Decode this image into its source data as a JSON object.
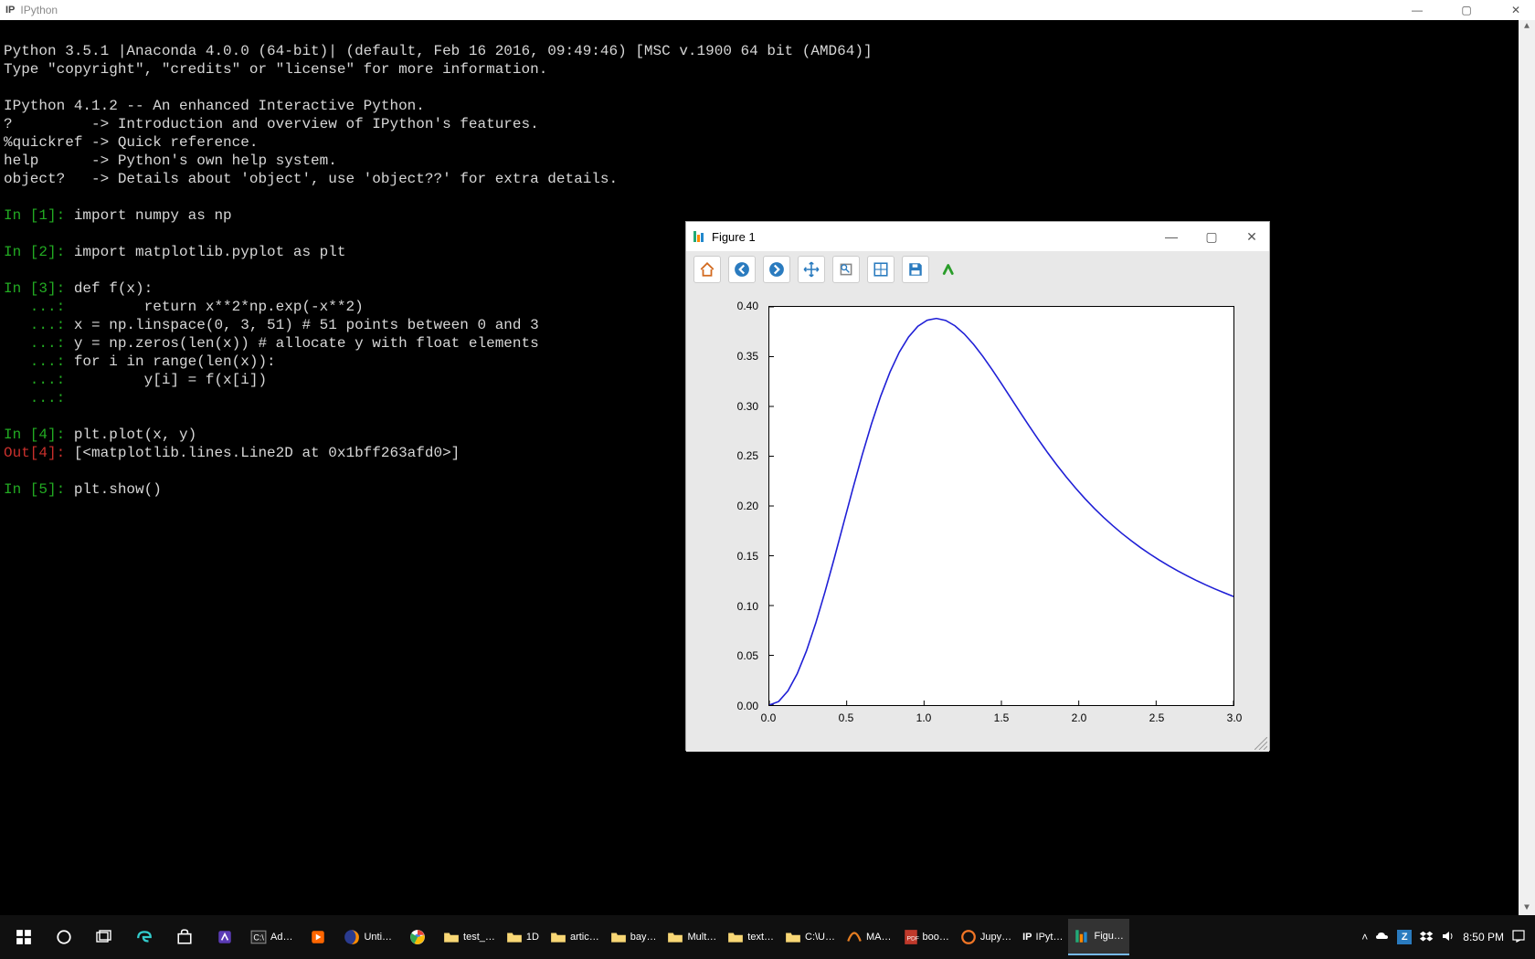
{
  "main_window": {
    "app_icon_text": "IP",
    "title": "IPython",
    "controls": {
      "min": "—",
      "max": "▢",
      "close": "✕"
    }
  },
  "terminal": {
    "line01": "Python 3.5.1 |Anaconda 4.0.0 (64-bit)| (default, Feb 16 2016, 09:49:46) [MSC v.1900 64 bit (AMD64)]",
    "line02": "Type \"copyright\", \"credits\" or \"license\" for more information.",
    "blank1": "",
    "line03": "IPython 4.1.2 -- An enhanced Interactive Python.",
    "line04": "?         -> Introduction and overview of IPython's features.",
    "line05": "%quickref -> Quick reference.",
    "line06": "help      -> Python's own help system.",
    "line07": "object?   -> Details about 'object', use 'object??' for extra details.",
    "blank2": "",
    "in1_prompt": "In [1]: ",
    "in1_code": "import numpy as np",
    "blank3": "",
    "in2_prompt": "In [2]: ",
    "in2_code": "import matplotlib.pyplot as plt",
    "blank4": "",
    "in3_prompt": "In [3]: ",
    "in3_code": "def f(x):",
    "cont_prompt": "   ...: ",
    "in3_l2": "        return x**2*np.exp(-x**2)",
    "in3_l3": "x = np.linspace(0, 3, 51) # 51 points between 0 and 3",
    "in3_l4": "y = np.zeros(len(x)) # allocate y with float elements",
    "in3_l5": "for i in range(len(x)):",
    "in3_l6": "        y[i] = f(x[i])",
    "in3_l7": "",
    "blank5": "",
    "in4_prompt": "In [4]: ",
    "in4_code": "plt.plot(x, y)",
    "out4_prompt": "Out[4]: ",
    "out4_val": "[<matplotlib.lines.Line2D at 0x1bff263afd0>]",
    "blank6": "",
    "in5_prompt": "In [5]: ",
    "in5_code": "plt.show()"
  },
  "figure_window": {
    "title": "Figure 1",
    "controls": {
      "min": "—",
      "max": "▢",
      "close": "✕"
    },
    "toolbar": {
      "home": "home-icon",
      "back": "back-icon",
      "forward": "forward-icon",
      "pan": "pan-icon",
      "zoom": "zoom-icon",
      "subplots": "subplots-icon",
      "save": "save-icon",
      "edit": "edit-icon"
    },
    "y_ticks": [
      "0.00",
      "0.05",
      "0.10",
      "0.15",
      "0.20",
      "0.25",
      "0.30",
      "0.35",
      "0.40"
    ],
    "x_ticks": [
      "0.0",
      "0.5",
      "1.0",
      "1.5",
      "2.0",
      "2.5",
      "3.0"
    ]
  },
  "chart_data": {
    "type": "line",
    "title": "",
    "xlabel": "",
    "ylabel": "",
    "xlim": [
      0.0,
      3.0
    ],
    "ylim": [
      0.0,
      0.4
    ],
    "x": [
      0.0,
      0.06,
      0.12,
      0.18,
      0.24,
      0.3,
      0.36,
      0.42,
      0.48,
      0.54,
      0.6,
      0.66,
      0.72,
      0.78,
      0.84,
      0.9,
      0.96,
      1.02,
      1.08,
      1.14,
      1.2,
      1.26,
      1.32,
      1.38,
      1.44,
      1.5,
      1.56,
      1.62,
      1.68,
      1.74,
      1.8,
      1.86,
      1.92,
      1.98,
      2.04,
      2.1,
      2.16,
      2.22,
      2.28,
      2.34,
      2.4,
      2.46,
      2.52,
      2.58,
      2.64,
      2.7,
      2.76,
      2.82,
      2.88,
      2.94,
      3.0
    ],
    "y": [
      0.0,
      0.0036,
      0.0142,
      0.0314,
      0.0544,
      0.0823,
      0.1138,
      0.1476,
      0.1826,
      0.2175,
      0.2511,
      0.2823,
      0.3104,
      0.3346,
      0.3545,
      0.3698,
      0.3805,
      0.3866,
      0.3884,
      0.3864,
      0.381,
      0.3728,
      0.3624,
      0.3503,
      0.337,
      0.323,
      0.3087,
      0.2943,
      0.2802,
      0.2665,
      0.2533,
      0.2408,
      0.229,
      0.2179,
      0.2074,
      0.1977,
      0.1886,
      0.1802,
      0.1723,
      0.165,
      0.1581,
      0.1517,
      0.1457,
      0.1401,
      0.1348,
      0.1299,
      0.1252,
      0.1208,
      0.1167,
      0.1128,
      0.1091
    ]
  },
  "taskbar": {
    "items": [
      {
        "id": "start",
        "label": ""
      },
      {
        "id": "cortana",
        "label": ""
      },
      {
        "id": "taskview",
        "label": ""
      },
      {
        "id": "edge",
        "label": ""
      },
      {
        "id": "store",
        "label": ""
      },
      {
        "id": "vscode",
        "label": ""
      },
      {
        "id": "cmd",
        "label": "Ad…"
      },
      {
        "id": "video",
        "label": ""
      },
      {
        "id": "firefox",
        "label": "Unti…"
      },
      {
        "id": "chrome",
        "label": ""
      },
      {
        "id": "folder1",
        "label": "test_…"
      },
      {
        "id": "folder2",
        "label": "1D"
      },
      {
        "id": "folder3",
        "label": "artic…"
      },
      {
        "id": "folder4",
        "label": "bay…"
      },
      {
        "id": "folder5",
        "label": "Mult…"
      },
      {
        "id": "folder6",
        "label": "text…"
      },
      {
        "id": "folder7",
        "label": "C:\\U…"
      },
      {
        "id": "matlab",
        "label": "MA…"
      },
      {
        "id": "pdf",
        "label": "boo…"
      },
      {
        "id": "jupyter",
        "label": "Jupy…"
      },
      {
        "id": "ipython",
        "label": "IPyt…"
      },
      {
        "id": "figure",
        "label": "Figu…"
      }
    ],
    "tray": {
      "chevron": "chevron-up-icon",
      "onedrive": "onedrive-icon",
      "z": "z-icon",
      "dropbox": "dropbox-icon",
      "volume": "volume-icon",
      "time": "8:50 PM",
      "action": "action-center-icon"
    }
  }
}
